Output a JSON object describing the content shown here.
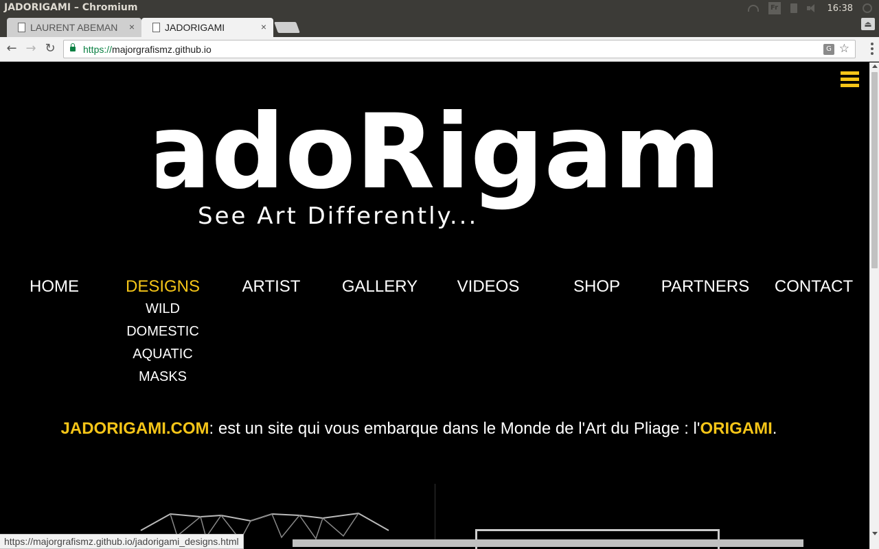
{
  "window": {
    "title": "JADORIGAMI – Chromium"
  },
  "tray": {
    "keyboard_label": "Fr",
    "clock": "16:38"
  },
  "tabs": [
    {
      "title": "LAURENT ABEMAN",
      "close": "×"
    },
    {
      "title": "JADORIGAMI",
      "close": "×"
    }
  ],
  "toolbar": {
    "back": "←",
    "forward": "→",
    "reload": "↻",
    "url_scheme": "https://",
    "url_host": "majorgrafismz.github.io",
    "star": "☆"
  },
  "logo": {
    "name": "jadoRigami",
    "tagline": "See Art Differently..."
  },
  "nav": {
    "items": [
      "HOME",
      "DESIGNS",
      "ARTIST",
      "GALLERY",
      "VIDEOS",
      "SHOP",
      "PARTNERS",
      "CONTACT"
    ],
    "active": "DESIGNS",
    "submenu": [
      "WILD",
      "DOMESTIC",
      "AQUATIC",
      "MASKS"
    ]
  },
  "intro": {
    "site": "JADORIGAMI.COM",
    "text": ": est un site qui vous embarque dans le Monde de l'Art du Pliage : l'",
    "highlight": "ORIGAMI",
    "end": "."
  },
  "status": {
    "link": "https://majorgrafismz.github.io/jadorigami_designs.html"
  },
  "colors": {
    "accent": "#f5c518",
    "background": "#000000",
    "secure": "#0b8043"
  }
}
